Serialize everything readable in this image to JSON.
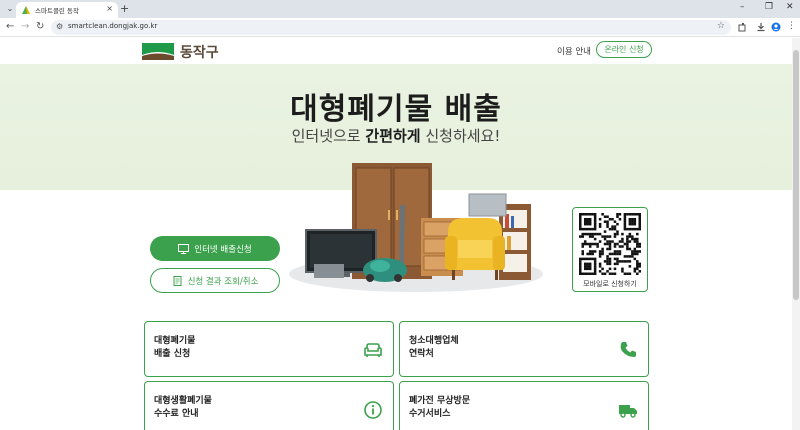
{
  "browser": {
    "tab_title": "스마트클린 동작",
    "tab_close": "×",
    "new_tab": "+",
    "url": "smartclean.dongjak.go.kr",
    "win_minimize": "–",
    "win_restore": "❐",
    "win_close": "✕",
    "nav_back": "←",
    "nav_forward": "→",
    "nav_reload": "↻",
    "site_info": "⚙",
    "bookmark": "☆",
    "tab_menu": "⌄",
    "menu_dots": "⋮"
  },
  "header": {
    "logo_text": "동작구",
    "nav_guide": "이용 안내",
    "nav_apply": "온라인 신청"
  },
  "hero": {
    "title": "대형폐기물 배출",
    "subtitle_pre": "인터넷으로 ",
    "subtitle_bold": "간편하게",
    "subtitle_post": " 신청하세요!"
  },
  "actions": {
    "primary_label": "인터넷 배출신청",
    "secondary_label": "신청 결과 조회/취소"
  },
  "qr": {
    "label": "모바일로 신청하기"
  },
  "cards": [
    {
      "label": "대형폐기물\n배출 신청",
      "icon": "sofa-icon"
    },
    {
      "label": "청소대행업체\n연락처",
      "icon": "phone-icon"
    },
    {
      "label": "대형생활폐기물\n수수료 안내",
      "icon": "info-icon"
    },
    {
      "label": "폐가전 무상방문\n수거서비스",
      "icon": "truck-icon"
    }
  ],
  "colors": {
    "accent": "#3ca14c",
    "hero_bg": "#e6f0dc"
  }
}
